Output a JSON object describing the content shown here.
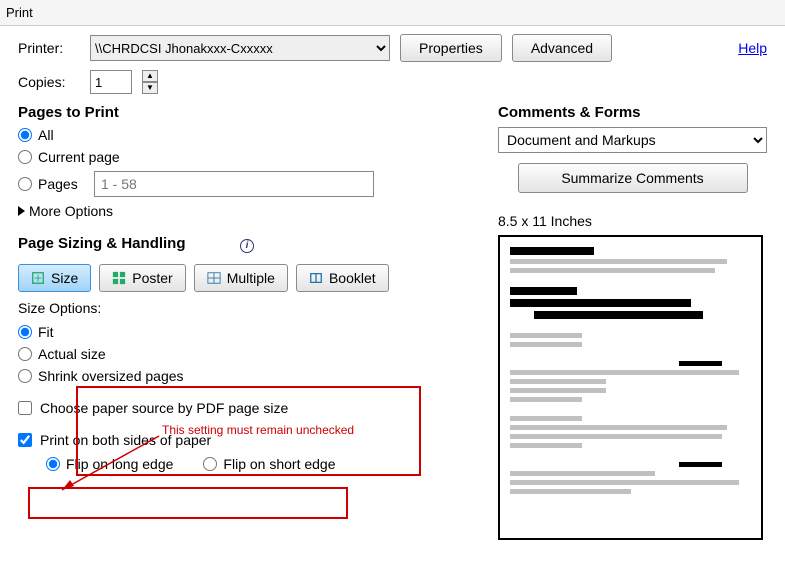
{
  "title": "Print",
  "top": {
    "printer_label": "Printer:",
    "printer_value": "\\\\CHRDCSI Jhonakxxx-Cxxxxx",
    "properties": "Properties",
    "advanced": "Advanced",
    "help": "Help",
    "copies_label": "Copies:",
    "copies_value": "1"
  },
  "pages_to_print": {
    "heading": "Pages to Print",
    "all": "All",
    "current": "Current page",
    "pages_label": "Pages",
    "pages_range": "1 - 58",
    "more": "More Options"
  },
  "sizing": {
    "heading": "Page Sizing & Handling",
    "tabs": {
      "size": "Size",
      "poster": "Poster",
      "multiple": "Multiple",
      "booklet": "Booklet"
    },
    "size_options_label": "Size Options:",
    "fit": "Fit",
    "actual": "Actual size",
    "shrink": "Shrink oversized pages",
    "choose_source": "Choose paper source by PDF page size",
    "duplex": "Print on both sides of paper",
    "flip_long": "Flip on long edge",
    "flip_short": "Flip on short edge"
  },
  "comments": {
    "heading": "Comments & Forms",
    "selected": "Document and Markups",
    "summarize": "Summarize Comments"
  },
  "preview": {
    "caption": "8.5 x 11 Inches"
  },
  "annotation": {
    "text": "This setting must remain unchecked"
  }
}
